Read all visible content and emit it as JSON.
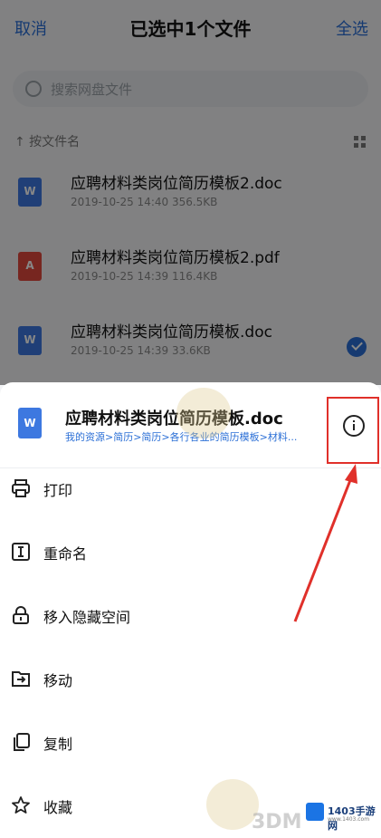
{
  "topbar": {
    "cancel_label": "取消",
    "title": "已选中1个文件",
    "select_all_label": "全选"
  },
  "search": {
    "placeholder": "搜索网盘文件"
  },
  "sort": {
    "label": "↑ 按文件名"
  },
  "files": [
    {
      "name": "应聘材料类岗位简历模板2.doc",
      "meta": "2019-10-25  14:40  356.5KB",
      "type": "doc",
      "icon_glyph": "W",
      "selected": false
    },
    {
      "name": "应聘材料类岗位简历模板2.pdf",
      "meta": "2019-10-25  14:39  116.4KB",
      "type": "pdf",
      "icon_glyph": "A",
      "selected": false
    },
    {
      "name": "应聘材料类岗位简历模板.doc",
      "meta": "2019-10-25  14:39  33.6KB",
      "type": "doc",
      "icon_glyph": "W",
      "selected": true
    }
  ],
  "sheet": {
    "file_icon_glyph": "W",
    "title": "应聘材料类岗位简历模板.doc",
    "path": "我的资源>简历>简历>各行各业的简历模板>材料...",
    "info_icon": "info-icon"
  },
  "menu": [
    {
      "label": "打印",
      "icon": "printer-icon"
    },
    {
      "label": "重命名",
      "icon": "rename-icon"
    },
    {
      "label": "移入隐藏空间",
      "icon": "lock-icon"
    },
    {
      "label": "移动",
      "icon": "move-icon"
    },
    {
      "label": "复制",
      "icon": "copy-icon"
    },
    {
      "label": "收藏",
      "icon": "star-icon"
    }
  ],
  "watermark": {
    "brand": "1403手游网",
    "sub": "www.1403.com",
    "logo_text": "3DM"
  },
  "colors": {
    "accent": "#2b6fd6",
    "highlight": "#e0302a",
    "doc": "#3d78e0",
    "pdf": "#e0483d"
  }
}
